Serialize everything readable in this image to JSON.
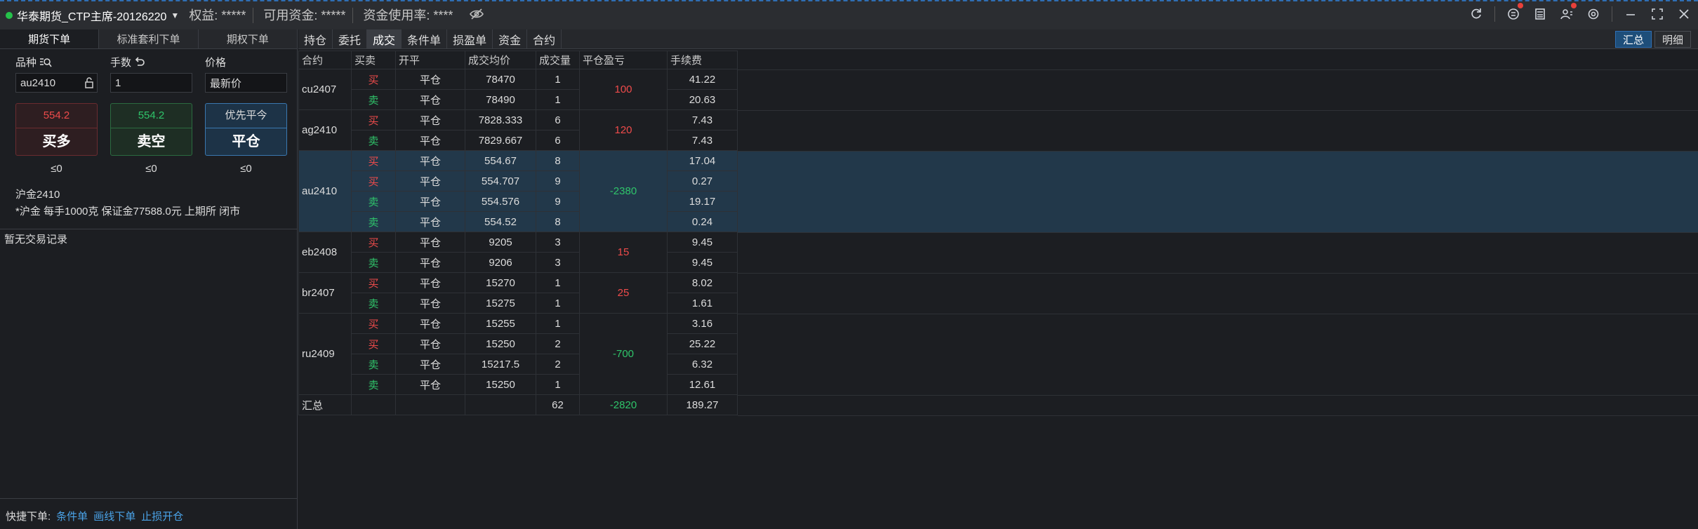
{
  "topbar": {
    "account": "华泰期货_CTP主席-20126220",
    "equity": "权益: *****",
    "available": "可用资金: *****",
    "usage": "资金使用率: ****"
  },
  "left": {
    "tabs": [
      "期货下单",
      "标准套利下单",
      "期权下单"
    ],
    "labels": {
      "variety": "品种",
      "qty": "手数",
      "price": "价格"
    },
    "inputs": {
      "variety": "au2410",
      "qty": "1",
      "price": "最新价"
    },
    "buttons": {
      "buy": {
        "price": "554.2",
        "label": "买多"
      },
      "sell": {
        "price": "554.2",
        "label": "卖空"
      },
      "close": {
        "price": "优先平今",
        "label": "平仓"
      }
    },
    "limits": [
      "≤0",
      "≤0",
      "≤0"
    ],
    "desc_name": "沪金2410",
    "desc_detail": "*沪金 每手1000克 保证金77588.0元 上期所 闭市",
    "no_records": "暂无交易记录",
    "quick_label": "快捷下单:",
    "quick_links": [
      "条件单",
      "画线下单",
      "止损开仓"
    ]
  },
  "right": {
    "tabs": [
      "持仓",
      "委托",
      "成交",
      "条件单",
      "损盈单",
      "资金",
      "合约"
    ],
    "active_tab": "成交",
    "view_buttons": [
      "汇总",
      "明细"
    ],
    "columns": [
      "合约",
      "买卖",
      "开平",
      "成交均价",
      "成交量",
      "平仓盈亏",
      "手续费"
    ],
    "groups": [
      {
        "contract": "cu2407",
        "pnl": "100",
        "pnl_sign": "pos",
        "rows": [
          {
            "side": "买",
            "oc": "平仓",
            "price": "78470",
            "vol": "1",
            "fee": "41.22"
          },
          {
            "side": "卖",
            "oc": "平仓",
            "price": "78490",
            "vol": "1",
            "fee": "20.63"
          }
        ]
      },
      {
        "contract": "ag2410",
        "pnl": "120",
        "pnl_sign": "pos",
        "rows": [
          {
            "side": "买",
            "oc": "平仓",
            "price": "7828.333",
            "vol": "6",
            "fee": "7.43"
          },
          {
            "side": "卖",
            "oc": "平仓",
            "price": "7829.667",
            "vol": "6",
            "fee": "7.43"
          }
        ]
      },
      {
        "contract": "au2410",
        "pnl": "-2380",
        "pnl_sign": "neg",
        "selected": true,
        "rows": [
          {
            "side": "买",
            "oc": "平仓",
            "price": "554.67",
            "vol": "8",
            "fee": "17.04"
          },
          {
            "side": "买",
            "oc": "平仓",
            "price": "554.707",
            "vol": "9",
            "fee": "0.27"
          },
          {
            "side": "卖",
            "oc": "平仓",
            "price": "554.576",
            "vol": "9",
            "fee": "19.17"
          },
          {
            "side": "卖",
            "oc": "平仓",
            "price": "554.52",
            "vol": "8",
            "fee": "0.24"
          }
        ]
      },
      {
        "contract": "eb2408",
        "pnl": "15",
        "pnl_sign": "pos",
        "rows": [
          {
            "side": "买",
            "oc": "平仓",
            "price": "9205",
            "vol": "3",
            "fee": "9.45"
          },
          {
            "side": "卖",
            "oc": "平仓",
            "price": "9206",
            "vol": "3",
            "fee": "9.45"
          }
        ]
      },
      {
        "contract": "br2407",
        "pnl": "25",
        "pnl_sign": "pos",
        "rows": [
          {
            "side": "买",
            "oc": "平仓",
            "price": "15270",
            "vol": "1",
            "fee": "8.02"
          },
          {
            "side": "卖",
            "oc": "平仓",
            "price": "15275",
            "vol": "1",
            "fee": "1.61"
          }
        ]
      },
      {
        "contract": "ru2409",
        "pnl": "-700",
        "pnl_sign": "neg",
        "rows": [
          {
            "side": "买",
            "oc": "平仓",
            "price": "15255",
            "vol": "1",
            "fee": "3.16"
          },
          {
            "side": "买",
            "oc": "平仓",
            "price": "15250",
            "vol": "2",
            "fee": "25.22"
          },
          {
            "side": "卖",
            "oc": "平仓",
            "price": "15217.5",
            "vol": "2",
            "fee": "6.32"
          },
          {
            "side": "卖",
            "oc": "平仓",
            "price": "15250",
            "vol": "1",
            "fee": "12.61"
          }
        ]
      }
    ],
    "total": {
      "label": "汇总",
      "vol": "62",
      "pnl": "-2820",
      "fee": "189.27"
    }
  }
}
